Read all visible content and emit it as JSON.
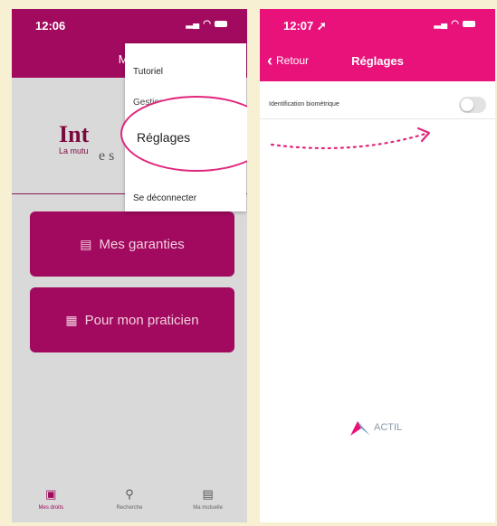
{
  "left_screen": {
    "status": {
      "time": "12:06"
    },
    "header_title": "Mes",
    "logo": {
      "main": "Int",
      "tagline": "La mutu",
      "mid": "e s"
    },
    "buttons": [
      {
        "label": "Mes garanties",
        "icon": "card-icon"
      },
      {
        "label": "Pour mon praticien",
        "icon": "qr-code-icon"
      }
    ],
    "menu": {
      "items": [
        "Tutoriel",
        "Gestion",
        "Réglages",
        "Se déconnecter"
      ]
    },
    "tabbar": [
      {
        "label": "Mes droits",
        "icon": "id-card-icon",
        "active": true
      },
      {
        "label": "Recherche",
        "icon": "search-icon",
        "active": false
      },
      {
        "label": "Ma mutuelle",
        "icon": "news-icon",
        "active": false
      }
    ]
  },
  "right_screen": {
    "status": {
      "time": "12:07"
    },
    "back_label": "Retour",
    "title": "Réglages",
    "settings": [
      {
        "label": "Identification biométrique",
        "enabled": false
      }
    ],
    "brand": "ACTIL"
  },
  "colors": {
    "left_header": "#a10a5e",
    "right_header": "#e8127a",
    "callout": "#e0267d",
    "background": "#f8f0d2"
  }
}
